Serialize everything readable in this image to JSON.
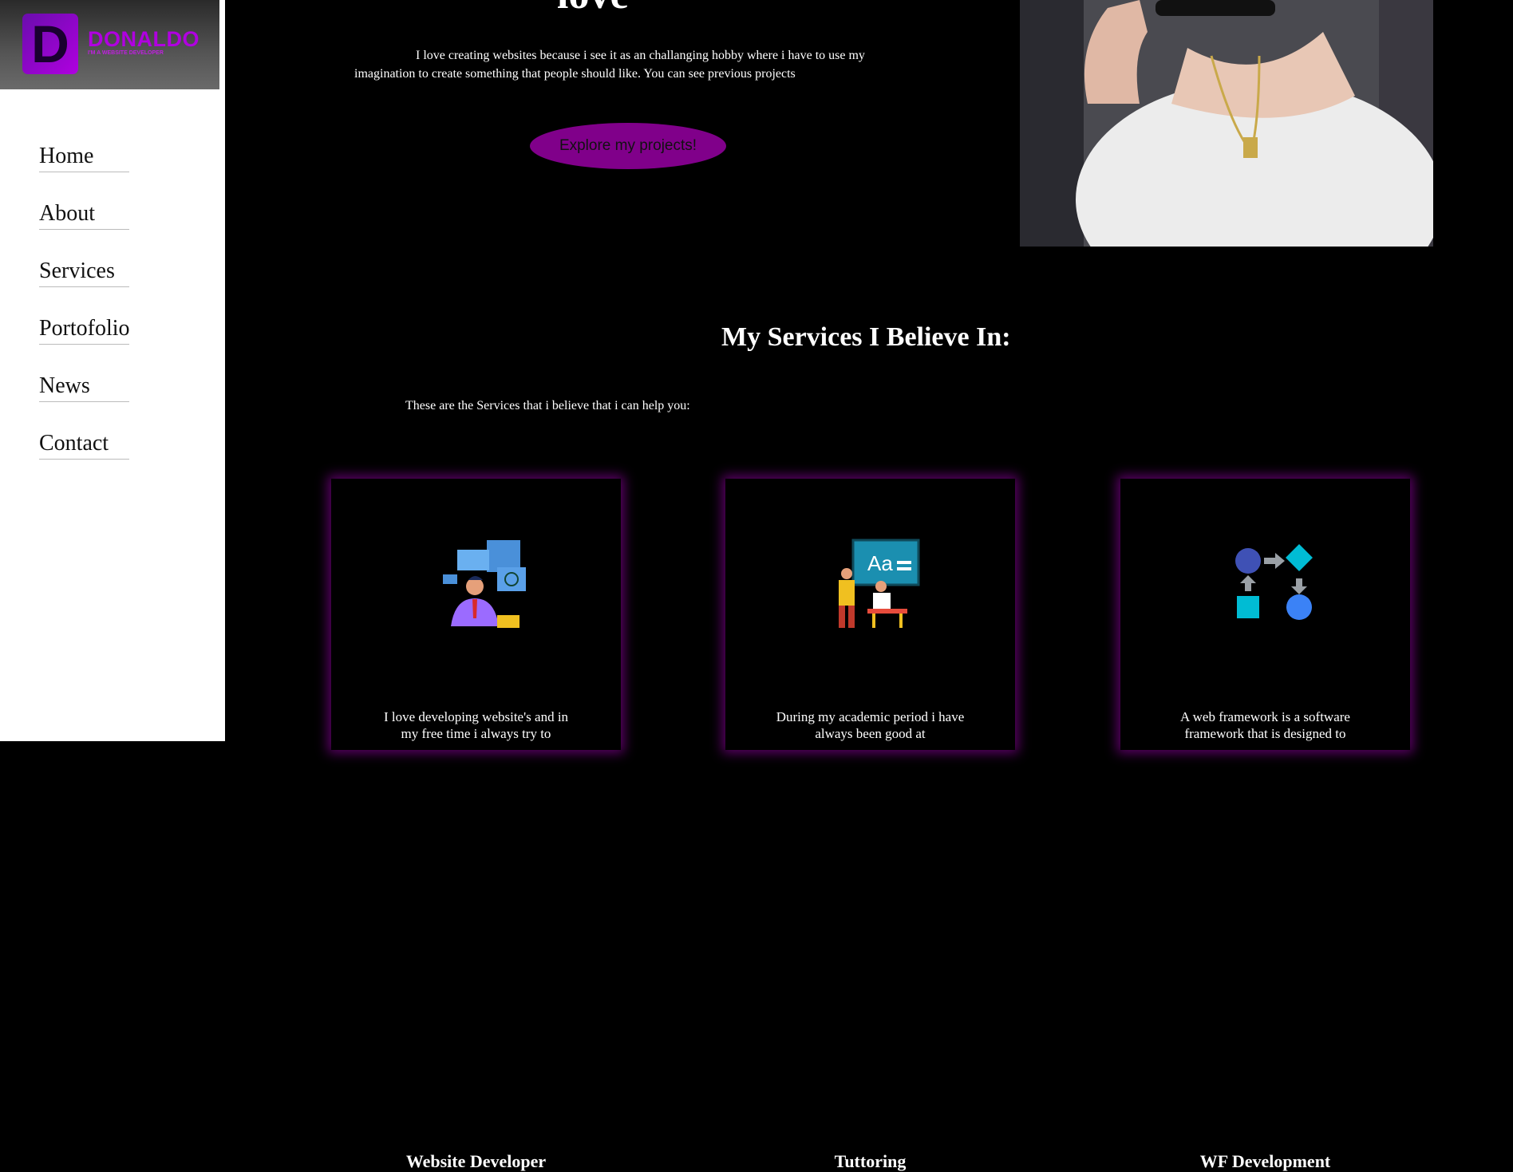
{
  "brand": {
    "initial": "D",
    "name": "DONALDO",
    "tagline": "I'M A WEBSITE DEVELOPER"
  },
  "nav": {
    "items": [
      {
        "label": "Home"
      },
      {
        "label": "About"
      },
      {
        "label": "Services"
      },
      {
        "label": "Portofolio"
      },
      {
        "label": "News"
      },
      {
        "label": "Contact"
      }
    ]
  },
  "hero": {
    "heading": "love",
    "text": "I love creating websites because i see it as an challanging hobby where i have to use my imagination to create something that people should like. You can see previous projects",
    "button_label": "Explore my projects!"
  },
  "services": {
    "title": "My Services I Believe In:",
    "subtitle": "These are the Services that i believe that i can help you:",
    "cards": [
      {
        "title": "Website Developer",
        "text": "I love developing website's and in my free time i always try to",
        "icon": "web-developer-icon"
      },
      {
        "title": "Tuttoring",
        "text": "During my academic period i have always been good at",
        "icon": "tutoring-icon"
      },
      {
        "title": "WF Development",
        "text": "A web framework is a software framework that is designed to",
        "icon": "workflow-icon"
      }
    ]
  },
  "colors": {
    "accent": "#80008a",
    "brand": "#b000e0",
    "glow": "#aa00be"
  }
}
